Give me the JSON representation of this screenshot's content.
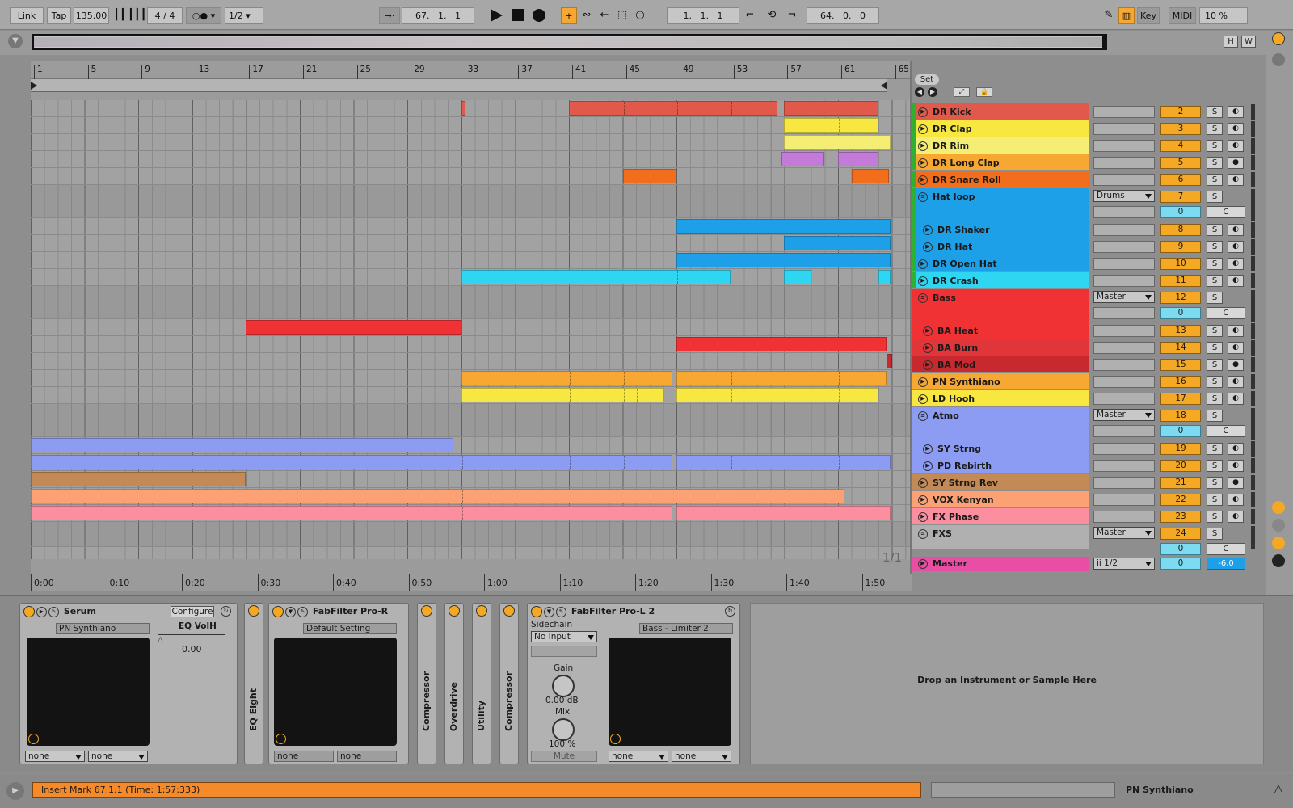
{
  "control_bar": {
    "link": "Link",
    "tap": "Tap",
    "tempo": "135.00",
    "signature": "4 / 4",
    "quantize": "1/2",
    "position": "67.   1.   1",
    "loop_start": "1.   1.   1",
    "loop_length": "64.   0.   0",
    "key": "Key",
    "midi": "MIDI",
    "cpu": "10 %"
  },
  "overview": {
    "h": "H",
    "w": "W"
  },
  "ruler": {
    "bars": [
      "1",
      "5",
      "9",
      "13",
      "17",
      "21",
      "25",
      "29",
      "33",
      "37",
      "41",
      "45",
      "49",
      "53",
      "57",
      "61",
      "65"
    ],
    "times": [
      "0:00",
      "0:10",
      "0:20",
      "0:30",
      "0:40",
      "0:50",
      "1:00",
      "1:10",
      "1:20",
      "1:30",
      "1:40",
      "1:50"
    ],
    "page": "1/1"
  },
  "set": {
    "label": "Set"
  },
  "tracks": [
    {
      "name": "DR Kick",
      "num": "2",
      "color": "#e0594a",
      "h": 21,
      "arm": "◐"
    },
    {
      "name": "DR Clap",
      "num": "3",
      "color": "#f7e740",
      "h": 21,
      "arm": "◐"
    },
    {
      "name": "DR Rim",
      "num": "4",
      "color": "#f5ee74",
      "h": 21,
      "arm": "◐"
    },
    {
      "name": "DR Long Clap",
      "num": "5",
      "color": "#f7a832",
      "h": 21,
      "arm": "●"
    },
    {
      "name": "DR Snare Roll",
      "num": "6",
      "color": "#f26e1c",
      "h": 21,
      "arm": "◐"
    },
    {
      "name": "Hat loop",
      "num": "7",
      "color": "#1ea0e8",
      "h": 41,
      "group": true,
      "io": "Drums",
      "send": "0"
    },
    {
      "name": "DR Shaker",
      "num": "8",
      "color": "#1ea0e8",
      "h": 21,
      "arm": "◐",
      "indent": true
    },
    {
      "name": "DR Hat",
      "num": "9",
      "color": "#1ea0e8",
      "h": 21,
      "arm": "◐",
      "indent": true
    },
    {
      "name": "DR Open Hat",
      "num": "10",
      "color": "#1ea0e8",
      "h": 21,
      "arm": "◐"
    },
    {
      "name": "DR Crash",
      "num": "11",
      "color": "#2ed6f2",
      "h": 21,
      "arm": "◐"
    },
    {
      "name": "Bass",
      "num": "12",
      "color": "#f03235",
      "h": 41,
      "group": true,
      "io": "Master",
      "send": "0"
    },
    {
      "name": "BA Heat",
      "num": "13",
      "color": "#f03235",
      "h": 21,
      "arm": "◐",
      "indent": true
    },
    {
      "name": "BA Burn",
      "num": "14",
      "color": "#e0363a",
      "h": 21,
      "arm": "◐",
      "indent": true
    },
    {
      "name": "BA Mod",
      "num": "15",
      "color": "#c8292e",
      "h": 21,
      "arm": "●",
      "indent": true
    },
    {
      "name": "PN Synthiano",
      "num": "16",
      "color": "#f7a832",
      "h": 21,
      "arm": "◐"
    },
    {
      "name": "LD Hooh",
      "num": "17",
      "color": "#f7e740",
      "h": 21,
      "arm": "◐"
    },
    {
      "name": "Atmo",
      "num": "18",
      "color": "#8c9cf3",
      "h": 41,
      "group": true,
      "io": "Master",
      "send": "0"
    },
    {
      "name": "SY Strng",
      "num": "19",
      "color": "#8c9cf3",
      "h": 21,
      "arm": "◐",
      "indent": true
    },
    {
      "name": "PD Rebirth",
      "num": "20",
      "color": "#8c9cf3",
      "h": 21,
      "arm": "◐",
      "indent": true
    },
    {
      "name": "SY Strng Rev",
      "num": "21",
      "color": "#c48a55",
      "h": 21,
      "arm": "●"
    },
    {
      "name": "VOX Kenyan",
      "num": "22",
      "color": "#fba173",
      "h": 21,
      "arm": "◐"
    },
    {
      "name": "FX Phase",
      "num": "23",
      "color": "#fb8fa0",
      "h": 21,
      "arm": "◐"
    },
    {
      "name": "FXS",
      "num": "24",
      "color": "#b0b0b0",
      "h": 31,
      "group": true,
      "io": "Master",
      "send": "0"
    }
  ],
  "master": {
    "name": "Master",
    "io": "ii 1/2",
    "send": "0",
    "vol": "-6.0",
    "color": "#e84fa4"
  },
  "clips": [
    {
      "t": 0,
      "b": 33,
      "e": 33.3,
      "c": "#e0594a"
    },
    {
      "t": 0,
      "b": 41,
      "e": 56.5,
      "c": "#e0594a",
      "m": [
        45,
        49,
        53
      ]
    },
    {
      "t": 0,
      "b": 57,
      "e": 64,
      "c": "#e0594a"
    },
    {
      "t": 1,
      "b": 57,
      "e": 64,
      "c": "#f7e740",
      "m": [
        61
      ]
    },
    {
      "t": 2,
      "b": 57,
      "e": 64.9,
      "c": "#f5ee74"
    },
    {
      "t": 3,
      "b": 56.8,
      "e": 60,
      "c": "#c47ad8"
    },
    {
      "t": 3,
      "b": 61,
      "e": 64,
      "c": "#c47ad8"
    },
    {
      "t": 4,
      "b": 45,
      "e": 49,
      "c": "#f26e1c"
    },
    {
      "t": 4,
      "b": 62,
      "e": 64.8,
      "c": "#f26e1c"
    },
    {
      "t": 6,
      "b": 49,
      "e": 64.9,
      "c": "#1ea0e8",
      "m": [
        57
      ]
    },
    {
      "t": 7,
      "b": 57,
      "e": 64.9,
      "c": "#1ea0e8"
    },
    {
      "t": 8,
      "b": 49,
      "e": 64.9,
      "c": "#1ea0e8",
      "m": [
        57
      ]
    },
    {
      "t": 9,
      "b": 33,
      "e": 53,
      "c": "#2ed6f2",
      "m": [
        49
      ]
    },
    {
      "t": 9,
      "b": 57,
      "e": 59,
      "c": "#2ed6f2"
    },
    {
      "t": 9,
      "b": 64,
      "e": 64.9,
      "c": "#2ed6f2"
    },
    {
      "t": 11,
      "b": 17,
      "e": 33,
      "c": "#f03235"
    },
    {
      "t": 12,
      "b": 49,
      "e": 64.6,
      "c": "#f03235"
    },
    {
      "t": 13,
      "b": 64.6,
      "e": 65,
      "c": "#c8292e"
    },
    {
      "t": 14,
      "b": 33,
      "e": 48.7,
      "c": "#f7a832",
      "m": [
        37,
        41,
        45
      ]
    },
    {
      "t": 14,
      "b": 49,
      "e": 64.6,
      "c": "#f7a832",
      "m": [
        53,
        57,
        61
      ]
    },
    {
      "t": 15,
      "b": 33,
      "e": 48,
      "c": "#f7e740",
      "m": [
        37,
        41,
        45,
        46,
        47
      ]
    },
    {
      "t": 15,
      "b": 49,
      "e": 64,
      "c": "#f7e740",
      "m": [
        53,
        57,
        61,
        62,
        63
      ]
    },
    {
      "t": 17,
      "b": 1,
      "e": 32.4,
      "c": "#8c9cf3"
    },
    {
      "t": 18,
      "b": 1,
      "e": 48.7,
      "c": "#8c9cf3",
      "m": [
        33,
        37,
        41,
        45
      ]
    },
    {
      "t": 18,
      "b": 49,
      "e": 64.9,
      "c": "#8c9cf3",
      "m": [
        53,
        57,
        61
      ]
    },
    {
      "t": 19,
      "b": 1,
      "e": 17,
      "c": "#c48a55"
    },
    {
      "t": 20,
      "b": 1,
      "e": 61.5,
      "c": "#fba173",
      "m": [
        33
      ]
    },
    {
      "t": 21,
      "b": 1,
      "e": 48.7,
      "c": "#fb8fa0",
      "m": [
        33
      ]
    },
    {
      "t": 21,
      "b": 49,
      "e": 64.9,
      "c": "#fb8fa0"
    }
  ],
  "devices": {
    "serum": {
      "title": "Serum",
      "configure": "Configure",
      "preset": "PN Synthiano",
      "param": "EQ VolH",
      "value": "0.00",
      "in1": "none",
      "in2": "none"
    },
    "eq_eight": {
      "label": "EQ Eight"
    },
    "fabfilter_q": {
      "title": "FabFilter Pro-R",
      "preset": "Default Setting",
      "in1": "none",
      "in2": "none"
    },
    "compressor1": {
      "label": "Compressor"
    },
    "overdrive": {
      "label": "Overdrive"
    },
    "utility": {
      "label": "Utility"
    },
    "compressor2": {
      "label": "Compressor"
    },
    "prol2": {
      "title": "FabFilter Pro-L 2",
      "sidechain": "Sidechain",
      "sc_input": "No Input",
      "gain_label": "Gain",
      "gain": "0.00 dB",
      "mix_label": "Mix",
      "mix": "100 %",
      "mute": "Mute",
      "preset": "Bass - Limiter 2",
      "in1": "none",
      "in2": "none"
    },
    "drop": "Drop an Instrument or Sample Here"
  },
  "status": {
    "message": "Insert Mark 67.1.1 (Time: 1:57:333)",
    "track": "PN Synthiano"
  }
}
